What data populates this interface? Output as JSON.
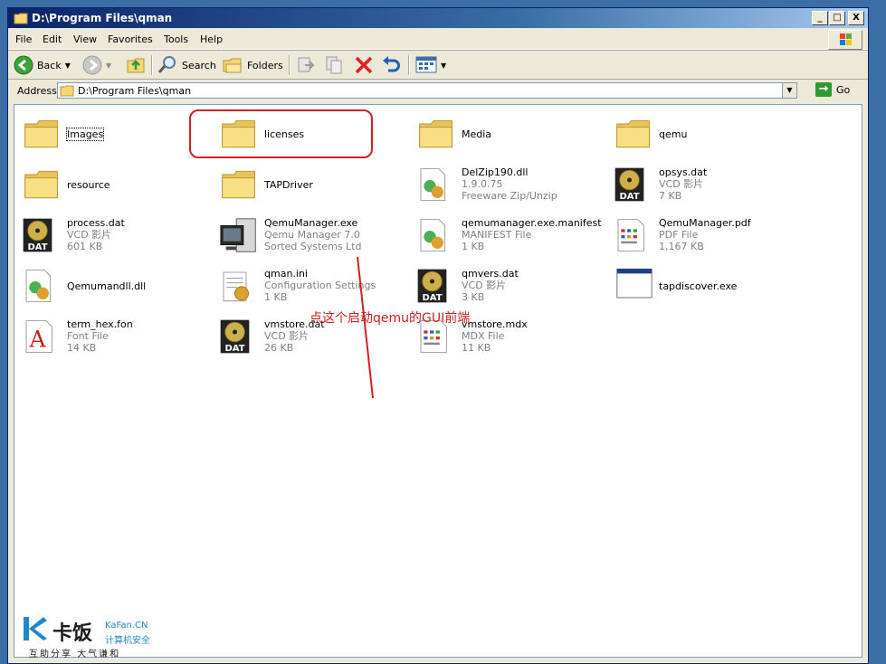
{
  "window": {
    "title": "D:\\Program Files\\qman",
    "controls": {
      "minimize": "_",
      "maximize": "□",
      "close": "X"
    }
  },
  "menu": {
    "file": "File",
    "edit": "Edit",
    "view": "View",
    "favorites": "Favorites",
    "tools": "Tools",
    "help": "Help"
  },
  "toolbar": {
    "back": "Back",
    "search": "Search",
    "folders": "Folders"
  },
  "address": {
    "label": "Address",
    "value": "D:\\Program Files\\qman",
    "go": "Go"
  },
  "files": [
    {
      "name": "Images",
      "icon": "folder-icon"
    },
    {
      "name": "licenses",
      "icon": "folder-icon"
    },
    {
      "name": "Media",
      "icon": "folder-icon"
    },
    {
      "name": "qemu",
      "icon": "folder-icon"
    },
    {
      "name": "resource",
      "icon": "folder-icon"
    },
    {
      "name": "TAPDriver",
      "icon": "folder-icon"
    },
    {
      "name": "DelZip190.dll",
      "line2": "1.9.0.75",
      "line3": "Freeware Zip/Unzip",
      "icon": "dll-icon"
    },
    {
      "name": "opsys.dat",
      "line2": "VCD 影片",
      "line3": "7 KB",
      "icon": "dat-icon"
    },
    {
      "name": "process.dat",
      "line2": "VCD 影片",
      "line3": "601 KB",
      "icon": "dat-icon"
    },
    {
      "name": "QemuManager.exe",
      "line2": "Qemu Manager 7.0",
      "line3": "Sorted Systems Ltd",
      "icon": "qemu-manager-icon"
    },
    {
      "name": "qemumanager.exe.manifest",
      "line2": "MANIFEST File",
      "line3": "1 KB",
      "icon": "settings-file-icon"
    },
    {
      "name": "QemuManager.pdf",
      "line2": "PDF File",
      "line3": "1,167 KB",
      "icon": "document-icon"
    },
    {
      "name": "Qemumandll.dll",
      "icon": "dll-icon"
    },
    {
      "name": "qman.ini",
      "line2": "Configuration Settings",
      "line3": "1 KB",
      "icon": "ini-icon"
    },
    {
      "name": "qmvers.dat",
      "line2": "VCD 影片",
      "line3": "3 KB",
      "icon": "dat-icon"
    },
    {
      "name": "tapdiscover.exe",
      "icon": "exe-window-icon"
    },
    {
      "name": "term_hex.fon",
      "line2": "Font File",
      "line3": "14 KB",
      "icon": "font-icon"
    },
    {
      "name": "vmstore.dat",
      "line2": "VCD 影片",
      "line3": "26 KB",
      "icon": "dat-icon"
    },
    {
      "name": "vmstore.mdx",
      "line2": "MDX File",
      "line3": "11 KB",
      "icon": "document-icon"
    }
  ],
  "annotation": {
    "text": "点这个启动qemu的GUI前端",
    "color": "#cc1f1f"
  },
  "watermark": {
    "brand": "卡饭",
    "site": "KaFan.CN",
    "subtitle": "计算机安全",
    "slogan": "互助分享  大气谦和"
  },
  "colors": {
    "desktop": "#3a6ea5",
    "titlebar": "#0a246a",
    "chrome": "#ece9d8",
    "folder": "#f5d875"
  }
}
